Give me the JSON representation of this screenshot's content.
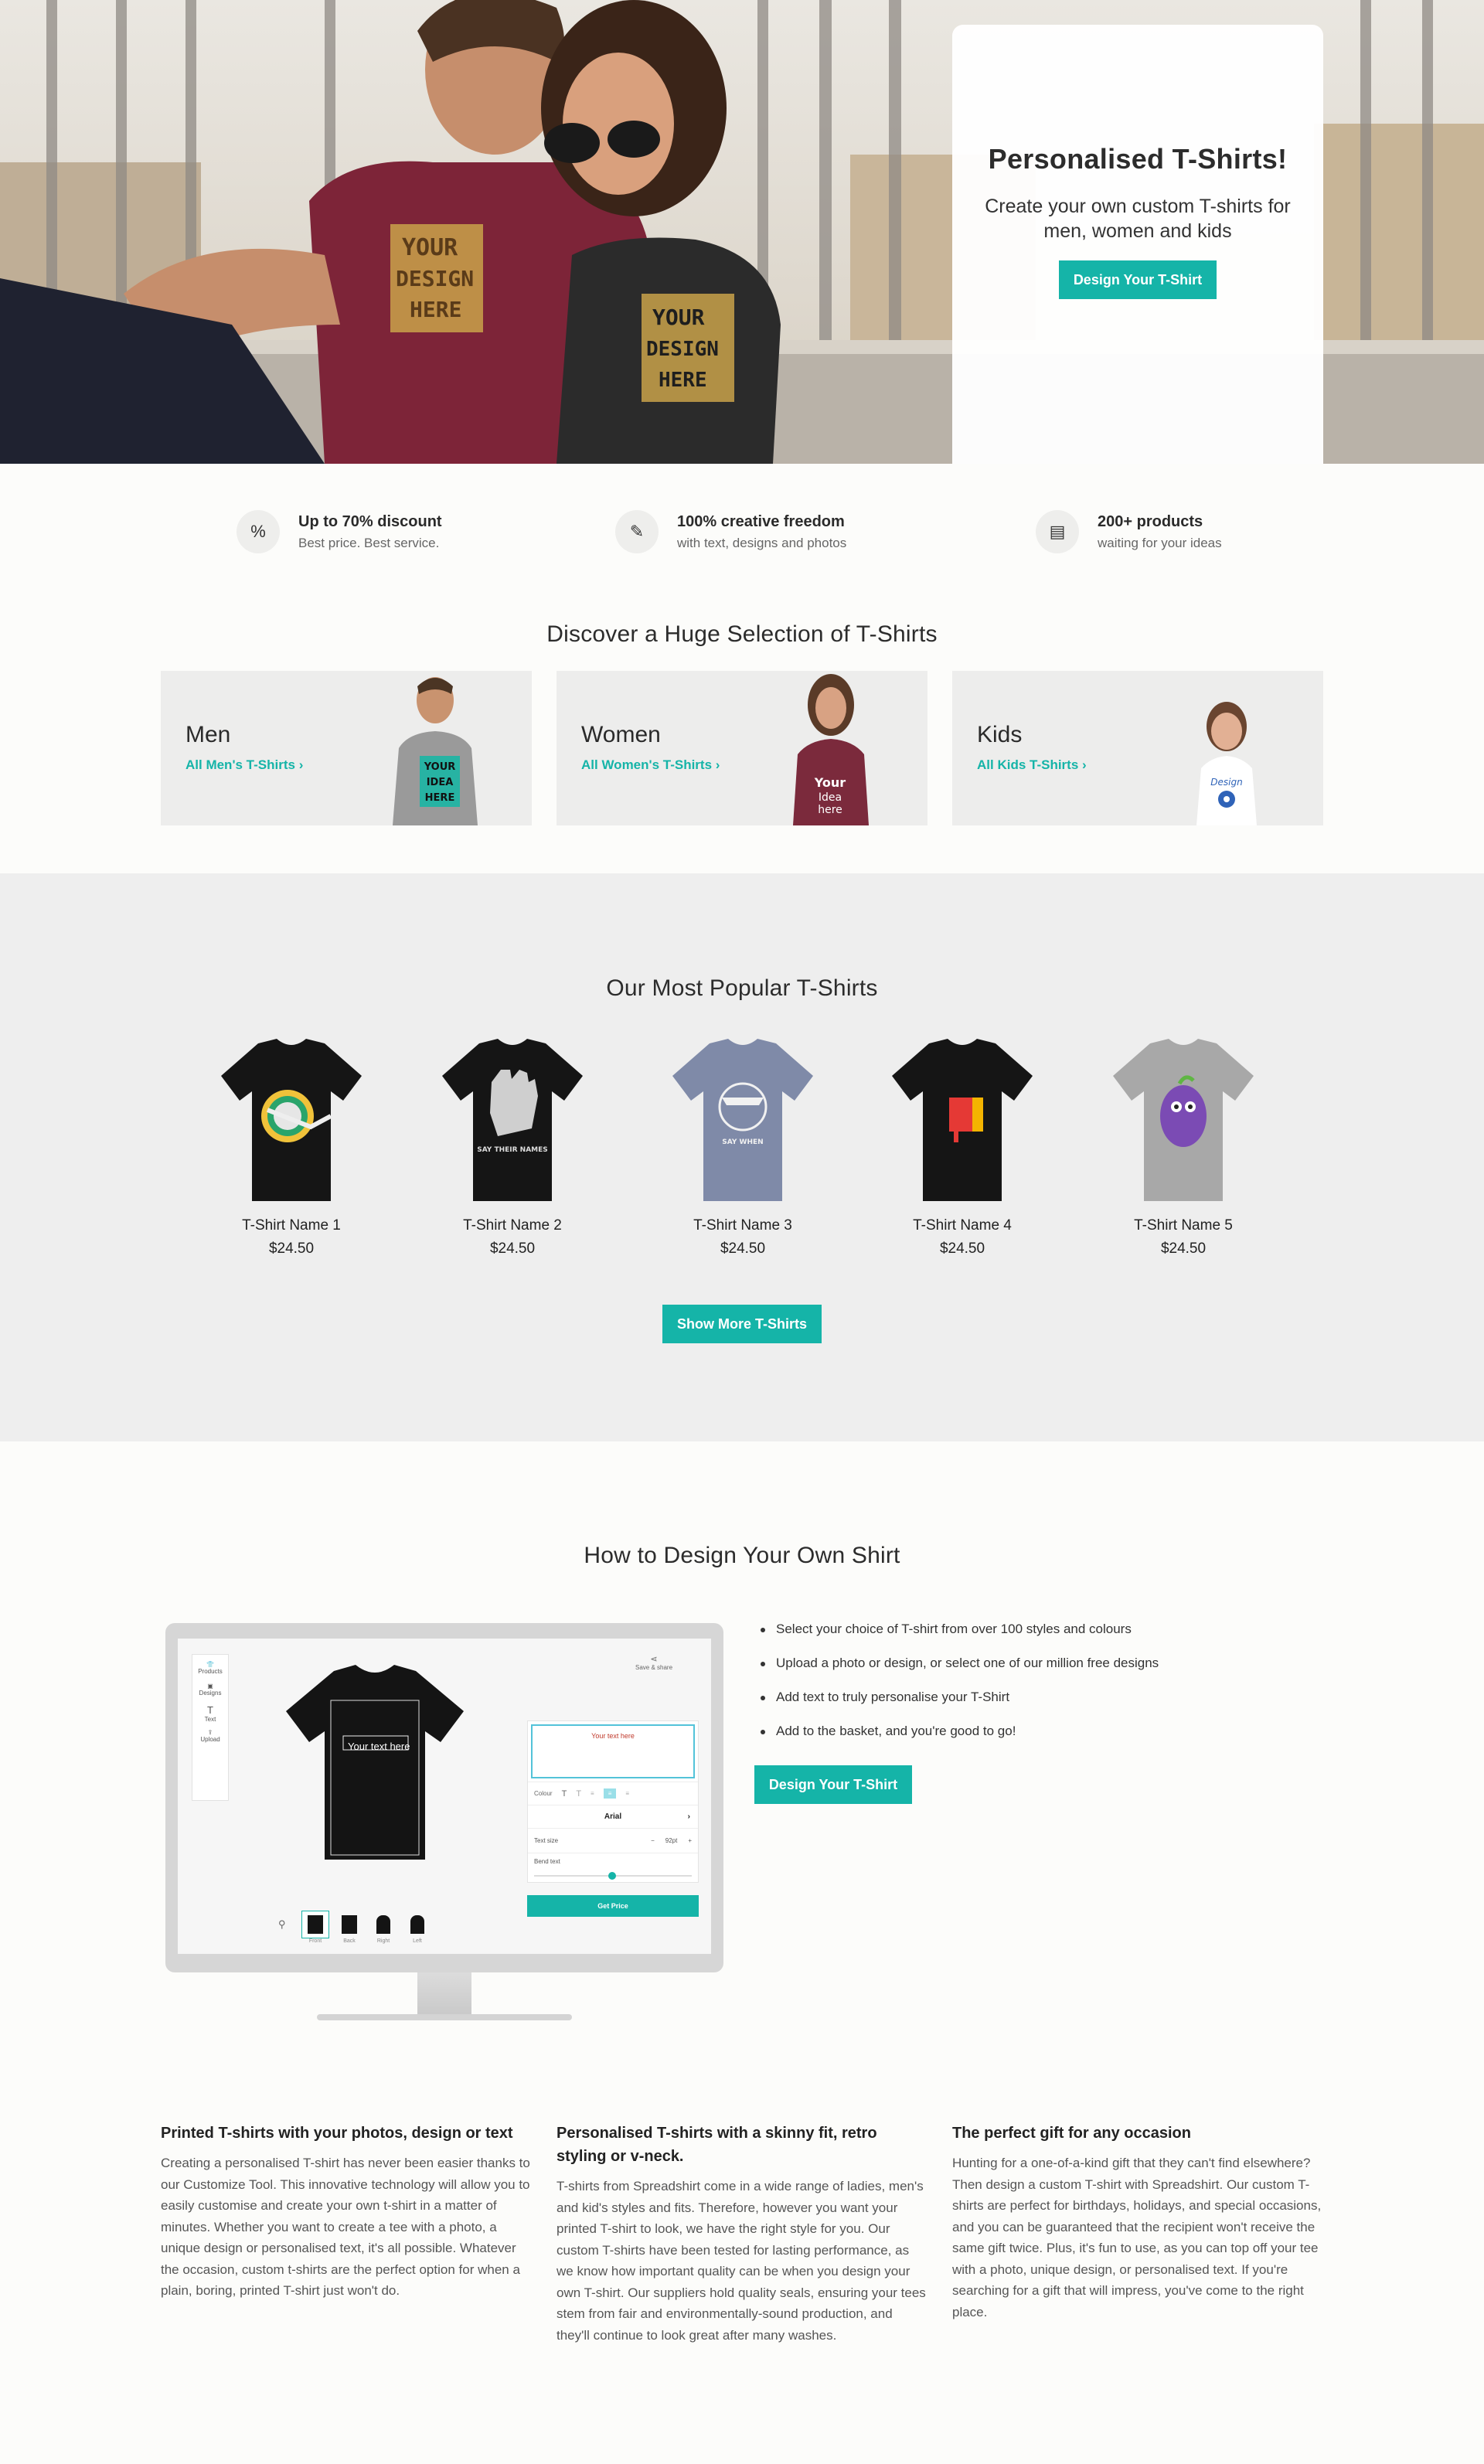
{
  "hero": {
    "title": "Personalised T-Shirts!",
    "subtitle": "Create your own custom T-shirts for men, women and kids",
    "button": "Design Your T-Shirt",
    "shirt_print": "YOUR DESIGN HERE"
  },
  "features": [
    {
      "icon": "percent-icon",
      "title": "Up to 70% discount",
      "subtitle": "Best price. Best service."
    },
    {
      "icon": "pencil-icon",
      "title": "100% creative freedom",
      "subtitle": "with text, designs and photos"
    },
    {
      "icon": "store-icon",
      "title": "200+ products",
      "subtitle": "waiting for your ideas"
    }
  ],
  "categories": {
    "title": "Discover a Huge Selection of T-Shirts",
    "items": [
      {
        "name": "Men",
        "link": "All Men's T-Shirts",
        "shirt_color": "#9a9a9a",
        "print": "YOUR IDEA HERE"
      },
      {
        "name": "Women",
        "link": "All Women's T-Shirts",
        "shirt_color": "#7b2a3c",
        "print": "Your Idea here"
      },
      {
        "name": "Kids",
        "link": "All Kids T-Shirts",
        "shirt_color": "#ffffff",
        "print": "Design"
      }
    ]
  },
  "popular": {
    "title": "Our Most Popular T-Shirts",
    "products": [
      {
        "name": "T-Shirt Name 1",
        "price": "$24.50",
        "color": "#151515"
      },
      {
        "name": "T-Shirt Name 2",
        "price": "$24.50",
        "color": "#151515"
      },
      {
        "name": "T-Shirt Name 3",
        "price": "$24.50",
        "color": "#7f8aa8"
      },
      {
        "name": "T-Shirt Name 4",
        "price": "$24.50",
        "color": "#151515"
      },
      {
        "name": "T-Shirt Name 5",
        "price": "$24.50",
        "color": "#a8a8a8"
      }
    ],
    "button": "Show More T-Shirts"
  },
  "howto": {
    "title": "How to Design Your Own Shirt",
    "steps": [
      "Select your choice of T-shirt from over 100 styles and colours",
      "Upload a photo or design, or select one of our million free designs",
      "Add text to truly personalise your T-Shirt",
      "Add to the basket, and you're good to go!"
    ],
    "button": "Design Your T-Shirt",
    "editor": {
      "sidebar": [
        "Products",
        "Designs",
        "Text",
        "Upload"
      ],
      "save_share": "Save & share",
      "shirt_text": "Your text here",
      "text_field": "Your text here",
      "colour_label": "Colour",
      "font": "Arial",
      "text_size_label": "Text size",
      "text_size_value": "92pt",
      "bend_label": "Bend text",
      "views": [
        "Front",
        "Back",
        "Right",
        "Left"
      ],
      "get_price": "Get Price"
    }
  },
  "articles": [
    {
      "title": "Printed T-shirts with your photos, design or text",
      "body": "Creating a personalised T-shirt has never been easier thanks to our Customize Tool. This innovative technology will allow you to easily customise and create your own t-shirt in a matter of minutes. Whether you want to create a tee with a photo, a unique design or personalised text, it's all possible. Whatever the occasion, custom t-shirts are the perfect option for when a plain, boring, printed T-shirt just won't do."
    },
    {
      "title": "Personalised T-shirts with a skinny fit, retro styling or v-neck.",
      "body": "T-shirts from Spreadshirt come in a wide range of ladies, men's and kid's styles and fits. Therefore, however you want your printed T-shirt to look, we have the right style for you. Our custom T-shirts have been tested for lasting performance, as we know how important quality can be when you design your own T-shirt. Our suppliers hold quality seals, ensuring your tees stem from fair and environmentally-sound production, and they'll continue to look great after many washes."
    },
    {
      "title": "The perfect gift for any occasion",
      "body": "Hunting for a one-of-a-kind gift that they can't find elsewhere? Then design a custom T-shirt with Spreadshirt. Our custom T-shirts are perfect for birthdays, holidays, and special occasions, and you can be guaranteed that the recipient won't receive the same gift twice. Plus, it's fun to use, as you can top off your tee with a photo, unique design, or personalised text. If you're searching for a gift that will impress, you've come to the right place."
    }
  ],
  "colors": {
    "accent": "#15b4a8",
    "page_bg": "#fcfcfa",
    "section_bg": "#eeeeee"
  }
}
